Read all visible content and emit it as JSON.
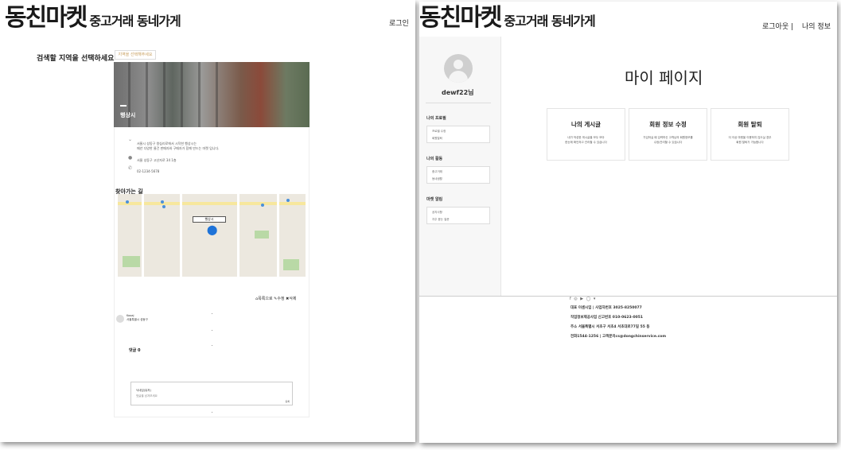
{
  "brand": {
    "logo_big": "동친마켓",
    "logo_small": "중고거래 동네가게"
  },
  "left": {
    "login": "로그인",
    "region_label": "검색할 지역을 선택하세요",
    "region_btn": "지역을 선택해주세요",
    "hero_title": "행상시",
    "info": [
      "서울시 성동구 왕십리로에서 시작한 행상시는\n매년 다양한 물건 판매자와 구매자가 함께 만드는 마켓 입니다.",
      "서울 성동구 고산자로 34 1층",
      "02-1234-5678"
    ],
    "directions_title": "찾아가는 길",
    "map_place": "행상시",
    "actions": "⌂목록으로 ✎수정 ✖삭제",
    "user": {
      "name": "Kooaj",
      "location": "서울특별시 성동구"
    },
    "comments": "댓글 0",
    "comment_box": {
      "who": "닉네임(유저)",
      "placeholder": "댓글을 남겨보세요",
      "submit": "등록"
    }
  },
  "right": {
    "logout": "로그아웃 |",
    "myinfo": "나의 정보",
    "username": "dewf22님",
    "groups": [
      {
        "title": "나의 프로필",
        "items": [
          "프로필 수정",
          "회원탈퇴"
        ]
      },
      {
        "title": "나의 활동",
        "items": [
          "중고거래",
          "동네생활"
        ]
      },
      {
        "title": "마켓 알림",
        "items": [
          "공지사항",
          "자주 묻는 질문"
        ]
      }
    ],
    "title": "마이 페이지",
    "tiles": [
      {
        "title": "나의 게시글",
        "desc": "내가 작성한 게시글을 모두 모아\n한눈에 확인하고 관리할 수 있습니다"
      },
      {
        "title": "회원 정보 수정",
        "desc": "가입하실 때 입력하신 고객님의 회원정보를\n수정/관리할 수 있습니다"
      },
      {
        "title": "회원 탈퇴",
        "desc": "더 이상 마켓을 이용하지 않으실 경우\n회원 탈퇴가 가능합니다"
      }
    ],
    "socials": "f ◎ ▶ ◯ ▾",
    "footer": [
      "대표 이센시입 | 사업자번호 3025-8250077",
      "직업정보제공사업 신고번호 010-0623-0051",
      "주소 서울특별시 서초구 서초4 서초대로77길 55 동",
      "전화1544-1256 | 고객문의cs@dongchinservice.com"
    ]
  }
}
